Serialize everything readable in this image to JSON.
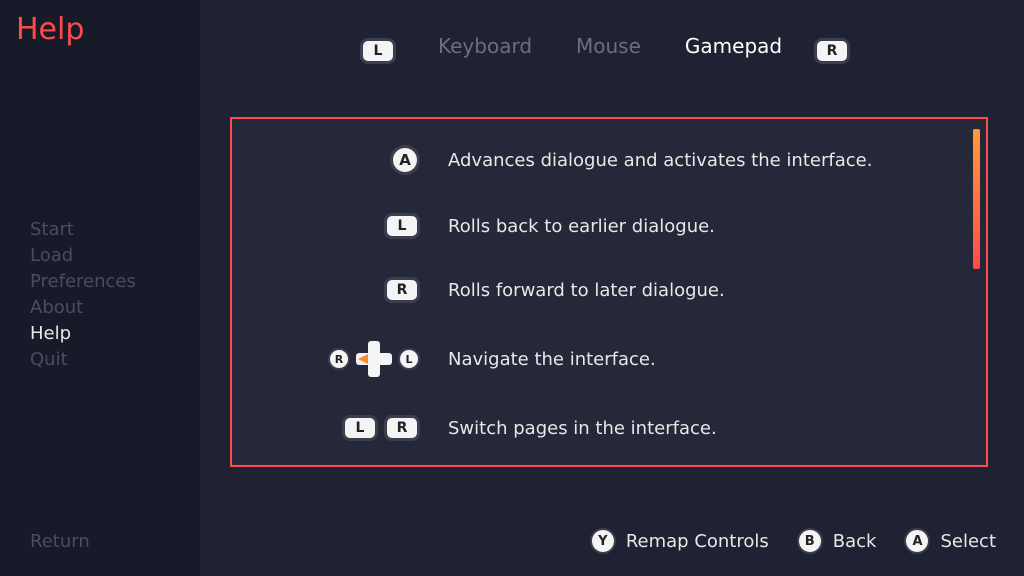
{
  "page_title": "Help",
  "menu": {
    "items": [
      {
        "label": "Start"
      },
      {
        "label": "Load"
      },
      {
        "label": "Preferences"
      },
      {
        "label": "About"
      },
      {
        "label": "Help"
      },
      {
        "label": "Quit"
      }
    ],
    "active_index": 4,
    "return_label": "Return"
  },
  "tabs": {
    "items": [
      {
        "label": "Keyboard"
      },
      {
        "label": "Mouse"
      },
      {
        "label": "Gamepad"
      }
    ],
    "active_index": 2,
    "prev_glyph": "L",
    "next_glyph": "R"
  },
  "help_rows": [
    {
      "glyphs": [
        {
          "type": "round",
          "text": "A"
        }
      ],
      "desc": "Advances dialogue and activates the interface."
    },
    {
      "glyphs": [
        {
          "type": "bumper",
          "text": "L"
        }
      ],
      "desc": "Rolls back to earlier dialogue."
    },
    {
      "glyphs": [
        {
          "type": "bumper",
          "text": "R"
        }
      ],
      "desc": "Rolls forward to later dialogue."
    },
    {
      "glyphs": [
        {
          "type": "round-small",
          "text": "R"
        },
        {
          "type": "dpad"
        },
        {
          "type": "round-small",
          "text": "L"
        }
      ],
      "desc": "Navigate the interface."
    },
    {
      "glyphs": [
        {
          "type": "bumper",
          "text": "L"
        },
        {
          "type": "bumper",
          "text": "R"
        }
      ],
      "desc": "Switch pages in the interface."
    }
  ],
  "footer": [
    {
      "glyph": "Y",
      "label": "Remap Controls"
    },
    {
      "glyph": "B",
      "label": "Back"
    },
    {
      "glyph": "A",
      "label": "Select"
    }
  ]
}
